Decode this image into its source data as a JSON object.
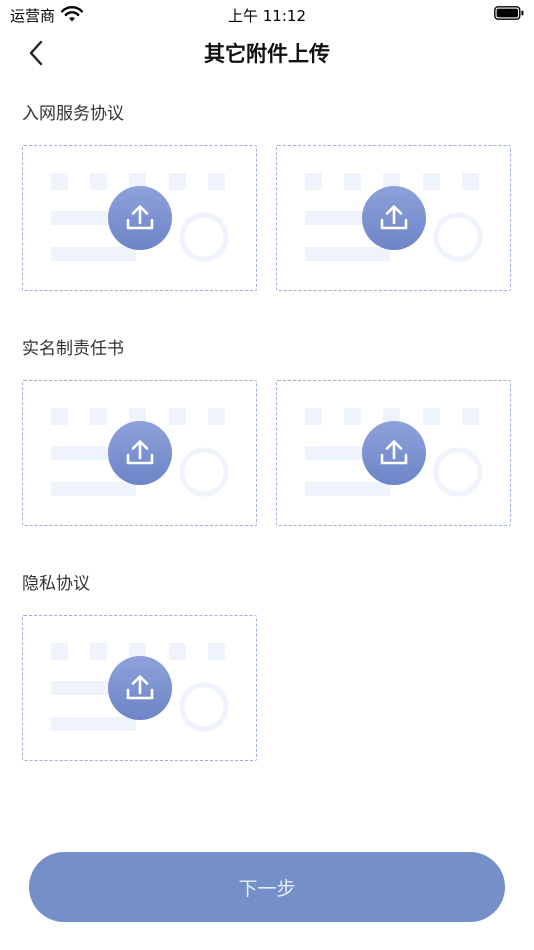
{
  "status_bar": {
    "carrier": "运营商",
    "time": "上午 11:12",
    "wifi_icon": "wifi-icon",
    "battery_icon": "battery-icon"
  },
  "nav": {
    "back_icon": "chevron-left-icon",
    "title": "其它附件上传"
  },
  "sections": [
    {
      "title": "入网服务协议",
      "upload_slots": 2
    },
    {
      "title": "实名制责任书",
      "upload_slots": 2
    },
    {
      "title": "隐私协议",
      "upload_slots": 1
    }
  ],
  "upload_icon": "upload-icon",
  "next_button": {
    "label": "下一步"
  },
  "colors": {
    "accent": "#7590c9",
    "upload_circle": "#7d93d0",
    "card_border": "#9fb0d6",
    "placeholder": "#eef3fc"
  }
}
